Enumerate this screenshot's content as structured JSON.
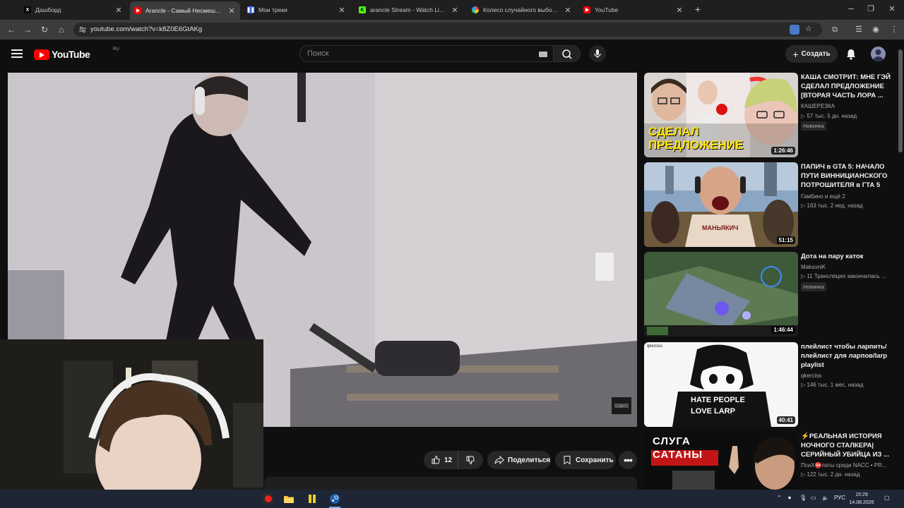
{
  "browser": {
    "tabs": [
      {
        "label": "Дашборд",
        "icon": "x-logo-icon",
        "active": false
      },
      {
        "label": "Arancle - Самый Несмешной",
        "icon": "youtube-favicon-icon",
        "active": true
      },
      {
        "label": "Мои треки",
        "icon": "pause-app-icon",
        "active": false
      },
      {
        "label": "arancle Stream - Watch Live on",
        "icon": "kick-logo-icon",
        "active": false
      },
      {
        "label": "Колесо случайного выбора –",
        "icon": "wheel-icon",
        "active": false
      },
      {
        "label": "YouTube",
        "icon": "youtube-favicon-icon",
        "active": false
      }
    ],
    "url": "youtube.com/watch?v=k8Z0E6GtAKg"
  },
  "youtube": {
    "logo_text": "YouTube",
    "region": "RU",
    "search_placeholder": "Поиск",
    "create_label": "Создать"
  },
  "video_actions": {
    "likes": "12",
    "share_label": "Поделиться",
    "save_label": "Сохранить"
  },
  "recommendations": [
    {
      "title": "КАША СМОТРИТ: МНЕ ГЭЙ СДЕЛАЛ ПРЕДЛОЖЕНИЕ [ВТОРАЯ ЧАСТЬ ЛОРА ...",
      "channel": "КАШЕРЕЗКА",
      "meta": "▷ 57 тыс.  5 дн. назад",
      "badge": "Новинка",
      "duration": "1:26:46",
      "thumb_text": "СДЕЛАЛ ПРЕДЛОЖЕНИЕ"
    },
    {
      "title": "ПАПИЧ в GTA 5: НАЧАЛО ПУТИ ВИННИЦИАНСКОГО ПОТРОШИТЕЛЯ в ГТА 5",
      "channel": "Гамбино и ещё 2",
      "meta": "▷ 163 тыс.  2 нед. назад",
      "badge": "",
      "duration": "51:15",
      "thumb_text": "МАНЬЯКИЧ"
    },
    {
      "title": "Дота на пару каток",
      "channel": "MaksoniK",
      "meta": "▷ 11  Трансляция закончилась ...",
      "badge": "Новинка",
      "duration": "1:46:44",
      "thumb_text": ""
    },
    {
      "title": "плейлист чтобы ларпить/ плейлист для ларпов/larp playlist",
      "channel": "qkerciss",
      "meta": "▷ 146 тыс.  1 мес. назад",
      "badge": "",
      "duration": "40:41",
      "thumb_text": "HATE PEOPLE LOVE LARP",
      "thumb_small": "qkerciss"
    },
    {
      "title": "⚡РЕАЛЬНАЯ ИСТОРИЯ НОЧНОГО СТАЛКЕРА| СЕРИЙНЫЙ УБИЙЦА ИЗ ...",
      "channel": "ПсиХ⛔паты среди NACC • PR...",
      "meta": "▷ 122 тыс.  2 дн. назад",
      "badge": "",
      "duration": "",
      "thumb_text": "СЛУГА САТАНЫ"
    }
  ],
  "taskbar": {
    "lang": "РУС",
    "time": "15:29",
    "date": "14.08.2026"
  }
}
